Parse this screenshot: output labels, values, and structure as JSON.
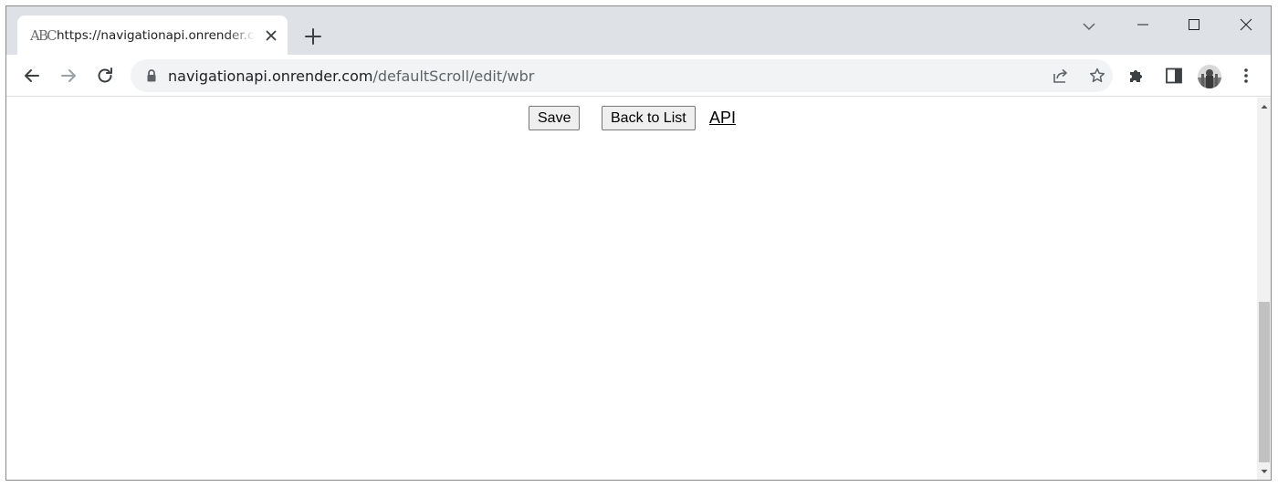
{
  "browser": {
    "tab": {
      "favicon_text": "ABC",
      "title": "https://navigationapi.onrender.com/defaultScroll/edit/wbr"
    },
    "address": {
      "host": "navigationapi.onrender.com",
      "path": "/defaultScroll/edit/wbr"
    },
    "icons": {
      "tab_close": "close-icon",
      "new_tab": "plus-icon",
      "tab_search": "chevron-down-icon",
      "minimize": "minimize-icon",
      "maximize": "maximize-icon",
      "close_window": "close-icon",
      "back": "arrow-left-icon",
      "forward": "arrow-right-icon",
      "reload": "reload-icon",
      "lock": "lock-icon",
      "share": "share-icon",
      "bookmark": "star-icon",
      "extensions": "puzzle-icon",
      "side_panel": "side-panel-icon",
      "profile": "avatar",
      "menu": "kebab-menu-icon"
    }
  },
  "page": {
    "save_label": "Save",
    "back_label": "Back to List",
    "api_link": "API"
  },
  "colors": {
    "tabbar_bg": "#dee1e6",
    "omnibox_bg": "#f1f3f4",
    "scroll_thumb": "#c1c1c1"
  }
}
